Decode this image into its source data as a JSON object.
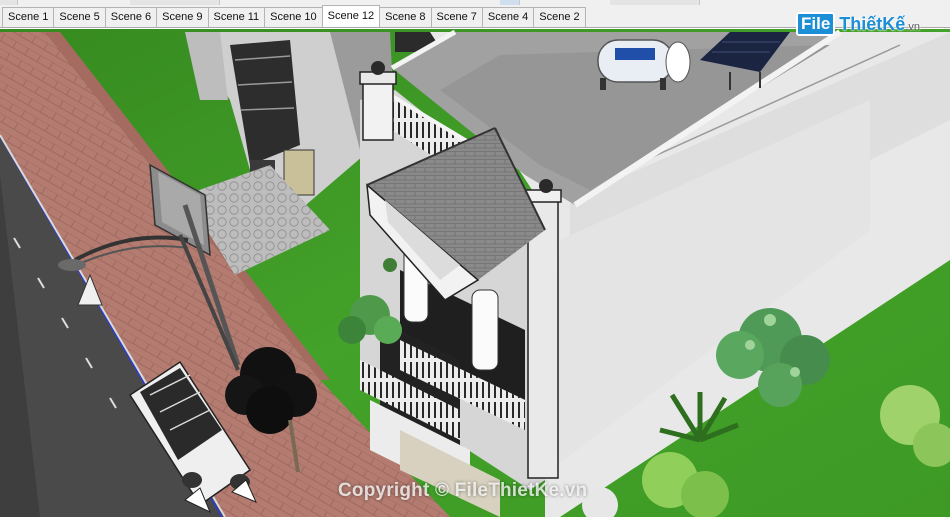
{
  "scene_tabs": [
    {
      "label": "Scene 1",
      "active": false
    },
    {
      "label": "Scene 5",
      "active": false
    },
    {
      "label": "Scene 6",
      "active": false
    },
    {
      "label": "Scene 9",
      "active": false
    },
    {
      "label": "Scene 11",
      "active": false
    },
    {
      "label": "Scene 10",
      "active": false
    },
    {
      "label": "Scene 12",
      "active": true
    },
    {
      "label": "Scene 8",
      "active": false
    },
    {
      "label": "Scene 7",
      "active": false
    },
    {
      "label": "Scene 4",
      "active": false
    },
    {
      "label": "Scene 2",
      "active": false
    }
  ],
  "logo": {
    "box_text": "File",
    "name": "ThiếtKế",
    "suffix": ".vn"
  },
  "watermark": "Copyright © FileThietKe.vn",
  "colors": {
    "grass": "#3f9a26",
    "road": "#4a4a4a",
    "sidewalk": "#b47b70",
    "building_wall": "#e6e6e6",
    "roof": "#8f8f8f",
    "logo_blue": "#1d8fd6"
  }
}
